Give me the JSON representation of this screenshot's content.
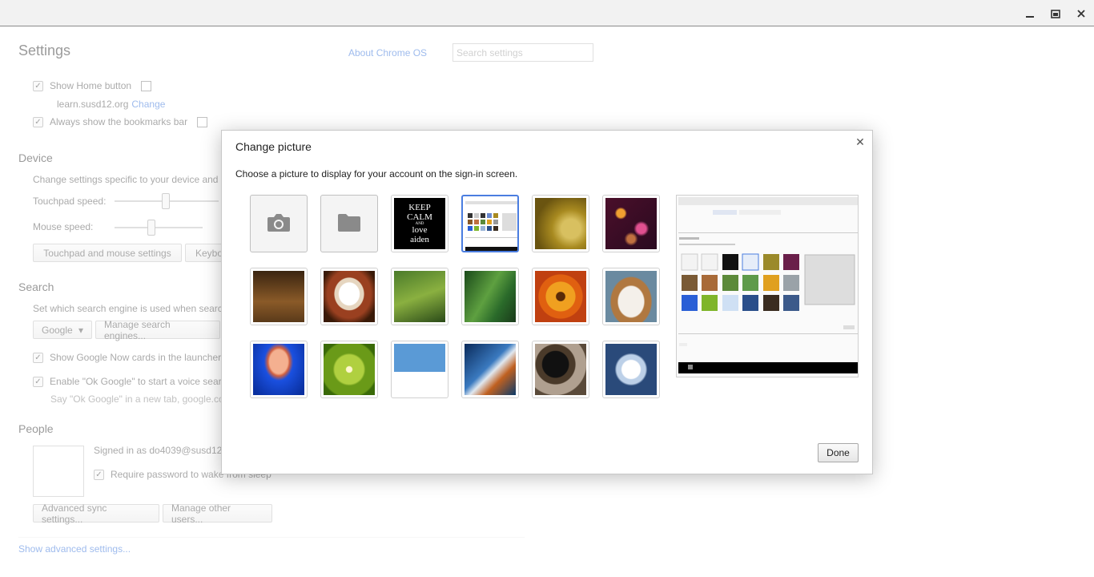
{
  "window": {
    "controls": [
      "minimize-icon",
      "restore-icon",
      "close-icon"
    ]
  },
  "settings": {
    "title": "Settings",
    "about_link": "About Chrome OS",
    "search_placeholder": "Search settings",
    "appearance": {
      "show_home": "Show Home button",
      "home_url": "learn.susd12.org",
      "change_link": "Change",
      "bookmarks": "Always show the bookmarks bar"
    },
    "device": {
      "heading": "Device",
      "desc": "Change settings specific to your device and",
      "touchpad_speed": "Touchpad speed:",
      "mouse_speed": "Mouse speed:",
      "touchpad_button": "Touchpad and mouse settings",
      "keyboard_button": "Keybo"
    },
    "search": {
      "heading": "Search",
      "desc": "Set which search engine is used when searc",
      "engine": "Google",
      "manage_button": "Manage search engines...",
      "google_now": "Show Google Now cards in the launcher",
      "ok_google": "Enable \"Ok Google\" to start a voice searc",
      "ok_google_hint": "Say \"Ok Google\" in a new tab, google.co"
    },
    "people": {
      "heading": "People",
      "signed_in": "Signed in as do4039@susd12",
      "require_password": "Require password to wake from sleep",
      "sync_button": "Advanced sync settings...",
      "manage_users_button": "Manage other users..."
    },
    "show_advanced": "Show advanced settings..."
  },
  "dialog": {
    "title": "Change picture",
    "description": "Choose a picture to display for your account on the sign-in screen.",
    "done_label": "Done",
    "keep_calm": {
      "line1": "KEEP",
      "line2": "CALM",
      "line3": "AND",
      "line4": "love",
      "line5": "aiden"
    },
    "pictures": [
      {
        "name": "camera-tile",
        "kind": "camera"
      },
      {
        "name": "file-tile",
        "kind": "folder"
      },
      {
        "name": "keep-calm-picture",
        "kind": "keepcalm"
      },
      {
        "name": "screenshot-picture",
        "kind": "screenshot",
        "selected": true
      },
      {
        "name": "bicycle-picture",
        "kind": "photo"
      },
      {
        "name": "bokeh-picture",
        "kind": "photo"
      },
      {
        "name": "chess-picture",
        "kind": "photo"
      },
      {
        "name": "coffee-picture",
        "kind": "photo"
      },
      {
        "name": "dragonfly-picture",
        "kind": "photo"
      },
      {
        "name": "frog-picture",
        "kind": "photo"
      },
      {
        "name": "flower-picture",
        "kind": "photo"
      },
      {
        "name": "dog-picture",
        "kind": "photo"
      },
      {
        "name": "jellyfish-picture",
        "kind": "photo"
      },
      {
        "name": "kiwi-picture",
        "kind": "photo"
      },
      {
        "name": "penguin-picture",
        "kind": "photo"
      },
      {
        "name": "fish-picture",
        "kind": "photo"
      },
      {
        "name": "turntable-picture",
        "kind": "photo"
      },
      {
        "name": "white-flower-picture",
        "kind": "photo"
      }
    ]
  }
}
